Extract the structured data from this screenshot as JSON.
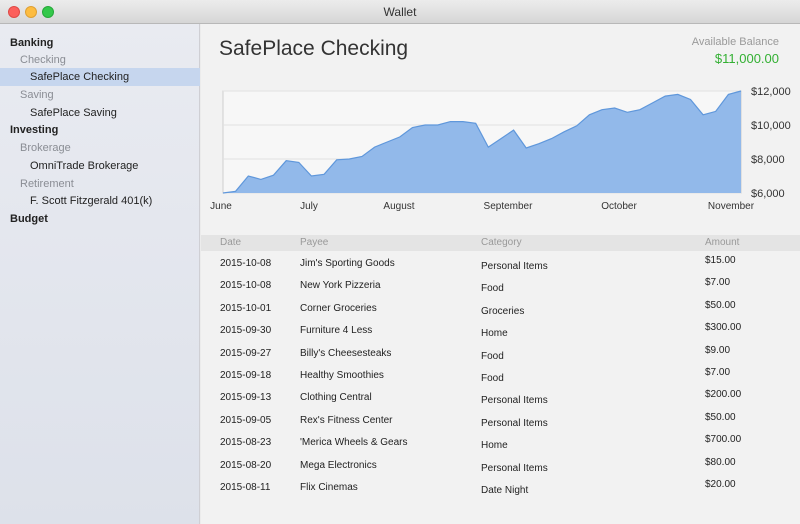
{
  "window": {
    "title": "Wallet"
  },
  "sidebar": {
    "items": [
      {
        "label": "Banking",
        "level": 1,
        "selected": false
      },
      {
        "label": "Checking",
        "level": 2,
        "selected": false
      },
      {
        "label": "SafePlace Checking",
        "level": 3,
        "selected": true
      },
      {
        "label": "Saving",
        "level": 2,
        "selected": false
      },
      {
        "label": "SafePlace Saving",
        "level": 3,
        "selected": false
      },
      {
        "label": "Investing",
        "level": 1,
        "selected": false
      },
      {
        "label": "Brokerage",
        "level": 2,
        "selected": false
      },
      {
        "label": "OmniTrade Brokerage",
        "level": 3,
        "selected": false
      },
      {
        "label": "Retirement",
        "level": 2,
        "selected": false
      },
      {
        "label": "F. Scott Fitzgerald 401(k)",
        "level": 3,
        "selected": false
      },
      {
        "label": "Budget",
        "level": 1,
        "selected": false
      }
    ]
  },
  "account": {
    "title": "SafePlace Checking",
    "balance_label": "Available Balance",
    "balance_value": "$11,000.00",
    "balance_color": "#33b033"
  },
  "chart_data": {
    "type": "area",
    "x_labels": [
      "June",
      "July",
      "August",
      "September",
      "October",
      "November"
    ],
    "y_ticks": [
      "$12,000",
      "$10,000",
      "$8,000",
      "$6,000"
    ],
    "ylim": [
      6000,
      12000
    ],
    "fill_color": "#92b9ea",
    "line_color": "#5f97db",
    "grid": true,
    "y_axis_position": "right",
    "values": [
      6000,
      6100,
      7000,
      6800,
      7050,
      7900,
      7800,
      7000,
      7100,
      7950,
      8000,
      8150,
      8700,
      9000,
      9300,
      9850,
      10000,
      10000,
      10200,
      10200,
      10100,
      8700,
      9200,
      9700,
      8650,
      8900,
      9200,
      9600,
      9950,
      10600,
      10900,
      11000,
      10750,
      10900,
      11300,
      11700,
      11800,
      11500,
      10600,
      10800,
      11800,
      12000
    ]
  },
  "table": {
    "headers": {
      "date": "Date",
      "payee": "Payee",
      "category": "Category",
      "amount": "Amount"
    },
    "rows": [
      {
        "date": "2015-10-08",
        "payee": "Jim's Sporting Goods",
        "category": "Personal Items",
        "amount": "$15.00"
      },
      {
        "date": "2015-10-08",
        "payee": "New York Pizzeria",
        "category": "Food",
        "amount": "$7.00"
      },
      {
        "date": "2015-10-01",
        "payee": "Corner Groceries",
        "category": "Groceries",
        "amount": "$50.00"
      },
      {
        "date": "2015-09-30",
        "payee": "Furniture 4 Less",
        "category": "Home",
        "amount": "$300.00"
      },
      {
        "date": "2015-09-27",
        "payee": "Billy's Cheesesteaks",
        "category": "Food",
        "amount": "$9.00"
      },
      {
        "date": "2015-09-18",
        "payee": "Healthy Smoothies",
        "category": "Food",
        "amount": "$7.00"
      },
      {
        "date": "2015-09-13",
        "payee": "Clothing Central",
        "category": "Personal Items",
        "amount": "$200.00"
      },
      {
        "date": "2015-09-05",
        "payee": "Rex's Fitness Center",
        "category": "Personal Items",
        "amount": "$50.00"
      },
      {
        "date": "2015-08-23",
        "payee": "'Merica Wheels & Gears",
        "category": "Home",
        "amount": "$700.00"
      },
      {
        "date": "2015-08-20",
        "payee": "Mega Electronics",
        "category": "Personal Items",
        "amount": "$80.00"
      },
      {
        "date": "2015-08-11",
        "payee": "Flix Cinemas",
        "category": "Date Night",
        "amount": "$20.00"
      }
    ]
  }
}
